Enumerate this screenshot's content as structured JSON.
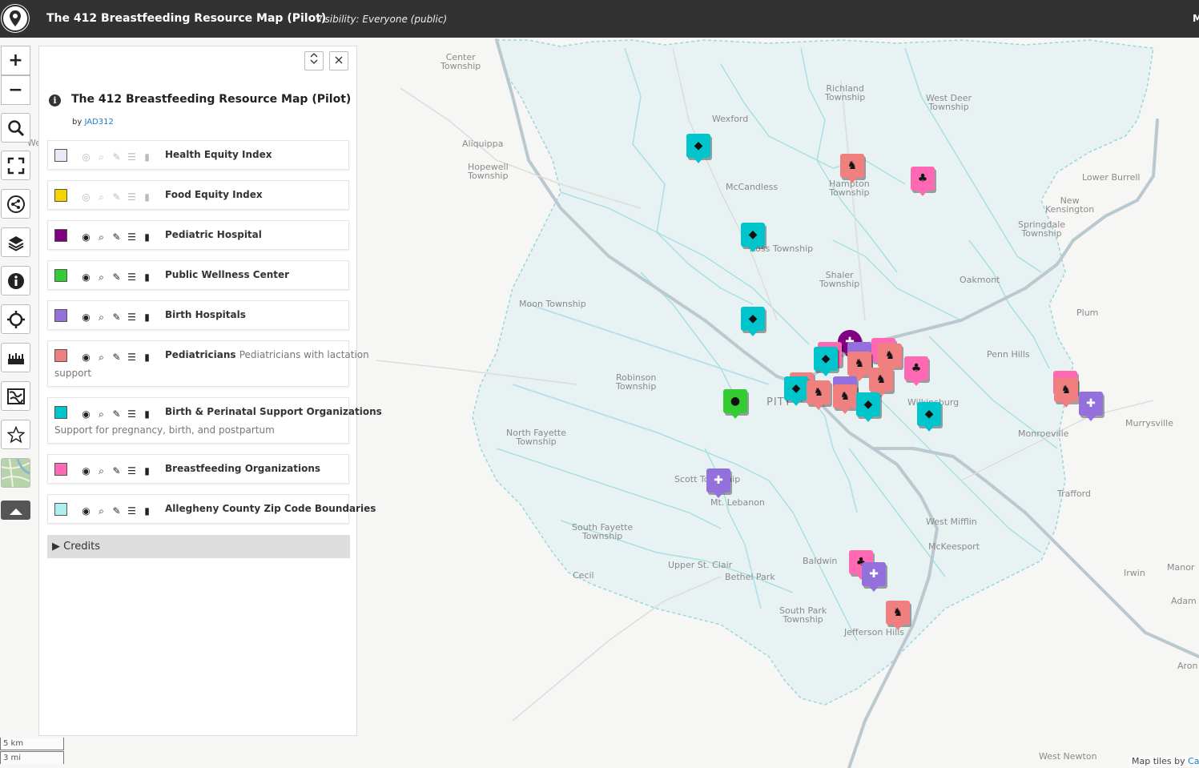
{
  "header": {
    "title": "The 412 Breastfeeding Resource Map (Pilot)",
    "visibility": "Visibility: Everyone (public)",
    "right_mark": "M"
  },
  "toolbar": {
    "zoom_in": "+",
    "zoom_out": "−"
  },
  "panel": {
    "title": "The 412 Breastfeeding Resource Map (Pilot)",
    "by_prefix": "by",
    "author": "JAD312",
    "layers": [
      {
        "name": "Health Equity Index",
        "desc": "",
        "color": "#e8e8f7",
        "visible": false
      },
      {
        "name": "Food Equity Index",
        "desc": "",
        "color": "#f5d400",
        "visible": false
      },
      {
        "name": "Pediatric Hospital",
        "desc": "",
        "color": "#800080",
        "visible": true
      },
      {
        "name": "Public Wellness Center",
        "desc": "",
        "color": "#33cc33",
        "visible": true
      },
      {
        "name": "Birth Hospitals",
        "desc": "",
        "color": "#9370db",
        "visible": true
      },
      {
        "name": "Pediatricians",
        "desc": "Pediatricians with lactation",
        "desc2": "support",
        "color": "#f08080",
        "visible": true
      },
      {
        "name": "Birth & Perinatal Support Organizations",
        "desc": "",
        "desc2": "Support for pregnancy, birth, and postpartum",
        "color": "#00c5cd",
        "visible": true
      },
      {
        "name": "Breastfeeding Organizations",
        "desc": "",
        "color": "#ff69b4",
        "visible": true
      },
      {
        "name": "Allegheny County Zip Code Boundaries",
        "desc": "",
        "color": "#aeeeee",
        "visible": true
      }
    ],
    "credits": "Credits"
  },
  "map": {
    "places": [
      {
        "name": "Center\nTownship"
      },
      {
        "name": "Richland\nTownship"
      },
      {
        "name": "West Deer\nTownship"
      },
      {
        "name": "Wexford"
      },
      {
        "name": "Aliquippa"
      },
      {
        "name": "Hopewell\nTownship"
      },
      {
        "name": "McCandless"
      },
      {
        "name": "Hampton\nTownship"
      },
      {
        "name": "Lower Burrell"
      },
      {
        "name": "New\nKensington"
      },
      {
        "name": "Springdale\nTownship"
      },
      {
        "name": "Ross Township"
      },
      {
        "name": "Shaler\nTownship"
      },
      {
        "name": "Oakmont"
      },
      {
        "name": "Moon Township"
      },
      {
        "name": "Plum"
      },
      {
        "name": "Penn Hills"
      },
      {
        "name": "Robinson\nTownship"
      },
      {
        "name": "PITT"
      },
      {
        "name": "Wilkinsburg"
      },
      {
        "name": "North Fayette\nTownship"
      },
      {
        "name": "Monroeville"
      },
      {
        "name": "Murrysville"
      },
      {
        "name": "Scott Township"
      },
      {
        "name": "Mt. Lebanon"
      },
      {
        "name": "Trafford"
      },
      {
        "name": "South Fayette\nTownship"
      },
      {
        "name": "West Mifflin"
      },
      {
        "name": "McKeesport"
      },
      {
        "name": "Baldwin"
      },
      {
        "name": "Upper St. Clair"
      },
      {
        "name": "Bethel Park"
      },
      {
        "name": "Cecil"
      },
      {
        "name": "Irwin"
      },
      {
        "name": "Manor"
      },
      {
        "name": "Adam"
      },
      {
        "name": "South Park\nTownship"
      },
      {
        "name": "Jefferson Hills"
      },
      {
        "name": "Aron"
      },
      {
        "name": "West Newton"
      },
      {
        "name": "We"
      }
    ],
    "markers": [
      {
        "type": "perinatal",
        "icon": "diamond-icon",
        "color": "#00c5cd"
      },
      {
        "type": "perinatal",
        "icon": "diamond-icon",
        "color": "#00c5cd"
      },
      {
        "type": "perinatal",
        "icon": "diamond-icon",
        "color": "#00c5cd"
      },
      {
        "type": "pediatrician",
        "icon": "rocking-horse-icon",
        "color": "#f08080"
      },
      {
        "type": "breastfeeding",
        "icon": "sprout-icon",
        "color": "#ff69b4"
      },
      {
        "type": "pediatric-hospital",
        "icon": "hospital-icon",
        "color": "#800080"
      },
      {
        "type": "perinatal",
        "icon": "diamond-icon",
        "color": "#00c5cd"
      },
      {
        "type": "birth-hospital",
        "icon": "cross-icon",
        "color": "#9370db"
      },
      {
        "type": "pediatrician",
        "icon": "rocking-horse-icon",
        "color": "#f08080"
      },
      {
        "type": "pediatrician",
        "icon": "rocking-horse-icon",
        "color": "#f08080"
      },
      {
        "type": "breastfeeding",
        "icon": "sprout-icon",
        "color": "#ff69b4"
      },
      {
        "type": "pediatrician",
        "icon": "rocking-horse-icon",
        "color": "#f08080"
      },
      {
        "type": "wellness",
        "icon": "apple-icon",
        "color": "#33cc33"
      },
      {
        "type": "pediatrician",
        "icon": "rocking-horse-icon",
        "color": "#f08080"
      },
      {
        "type": "perinatal",
        "icon": "diamond-icon",
        "color": "#00c5cd"
      },
      {
        "type": "pediatrician",
        "icon": "rocking-horse-icon",
        "color": "#f08080"
      },
      {
        "type": "birth-hospital",
        "icon": "cross-icon",
        "color": "#9370db"
      },
      {
        "type": "pediatrician",
        "icon": "rocking-horse-icon",
        "color": "#f08080"
      },
      {
        "type": "perinatal",
        "icon": "diamond-icon",
        "color": "#00c5cd"
      },
      {
        "type": "perinatal",
        "icon": "diamond-icon",
        "color": "#00c5cd"
      },
      {
        "type": "pediatrician",
        "icon": "rocking-horse-icon",
        "color": "#f08080"
      },
      {
        "type": "birth-hospital",
        "icon": "cross-icon",
        "color": "#9370db"
      },
      {
        "type": "birth-hospital",
        "icon": "cross-icon",
        "color": "#9370db"
      },
      {
        "type": "breastfeeding",
        "icon": "sprout-icon",
        "color": "#ff69b4"
      },
      {
        "type": "birth-hospital",
        "icon": "cross-icon",
        "color": "#9370db"
      },
      {
        "type": "pediatrician",
        "icon": "rocking-horse-icon",
        "color": "#f08080"
      }
    ]
  },
  "scale": {
    "km": "5 km",
    "mi": "3 mi"
  },
  "attribution": {
    "prefix": "Map tiles by",
    "link": "Car"
  }
}
